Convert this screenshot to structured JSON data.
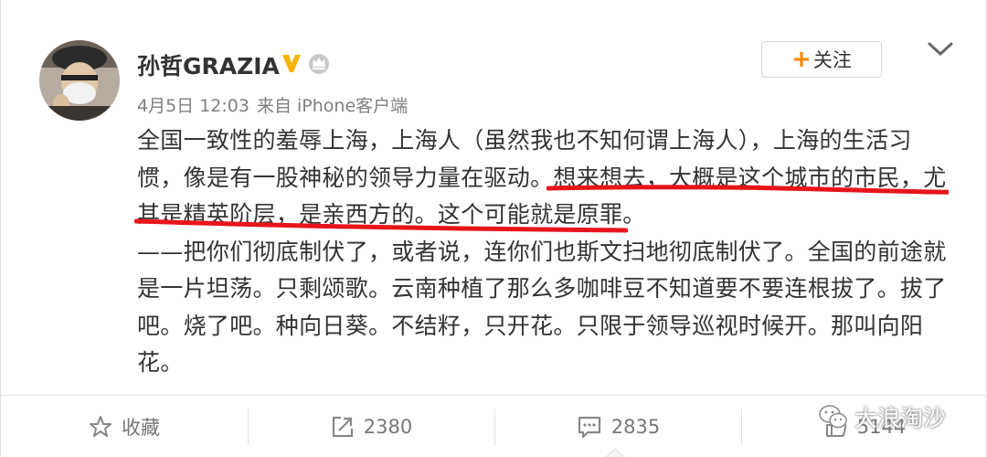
{
  "post": {
    "username": "孙哲GRAZIA",
    "verified_icon": "verified-v-icon",
    "member_icon": "crown-member-icon",
    "follow": {
      "plus": "+",
      "label": "关注"
    },
    "meta": {
      "date": "4月5日 12:03",
      "source": "来自 iPhone客户端"
    },
    "content": {
      "line1": "全国一致性的羞辱上海，上海人（虽然我也不知何谓上海人），上海的生活习",
      "line2": "惯，像是有一股神秘的领导力量在驱动。想来想去，大概是这个城市的市民，尤",
      "line3": "其是精英阶层，是亲西方的。这个可能就是原罪。",
      "line4": "——把你们彻底制伏了，或者说，连你们也斯文扫地彻底制伏了。全国的前途就",
      "line5": "是一片坦荡。只剩颂歌。云南种植了那么多咖啡豆不知道要不要连根拔了。拔了",
      "line6": "吧。烧了吧。种向日葵。不结籽，只开花。只限于领导巡视时候开。那叫向阳",
      "line7": "花。"
    }
  },
  "actions": {
    "favorite": {
      "icon": "star-icon",
      "label": "收藏"
    },
    "repost": {
      "icon": "share-icon",
      "label": "2380"
    },
    "comment": {
      "icon": "comment-icon",
      "label": "2835"
    },
    "like": {
      "icon": "thumb-up-icon",
      "label": "5144"
    }
  },
  "watermark": {
    "icon": "wechat-icon",
    "text": "大浪淘沙"
  },
  "colors": {
    "accent": "#ff8200",
    "underline": "#e8141c",
    "verified": "#f7b500"
  }
}
